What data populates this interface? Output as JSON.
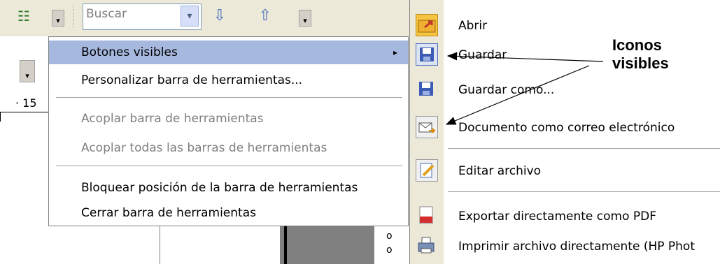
{
  "toolbar": {
    "search_placeholder": "Buscar",
    "search_combo_glyph": "▾",
    "icons": [
      "list-view-icon",
      "toolbar-options-icon",
      "search-down-icon",
      "search-up-icon",
      "toolbar-options-icon"
    ]
  },
  "ruler": {
    "value": "· 15"
  },
  "context_menu": {
    "items": [
      {
        "label": "Botones visibles",
        "enabled": true,
        "has_submenu": true,
        "highlighted": true
      },
      {
        "label": "Personalizar barra de herramientas...",
        "enabled": true
      },
      {
        "label": "Acoplar barra de herramientas",
        "enabled": false
      },
      {
        "label": "Acoplar todas las barras de herramientas",
        "enabled": false
      },
      {
        "label": "Bloquear posición de la barra de herramientas",
        "enabled": true
      },
      {
        "label": "Cerrar barra de herramientas",
        "enabled": true
      }
    ],
    "submenu_arrow": "▸"
  },
  "submenu": {
    "items": [
      {
        "label": "Abrir",
        "icon": "open-folder-icon"
      },
      {
        "label": "Guardar",
        "icon": "save-icon"
      },
      {
        "label": "Guardar como...",
        "icon": "save-as-icon"
      },
      {
        "label": "Documento como correo electrónico",
        "icon": "email-icon"
      },
      {
        "label": "Editar archivo",
        "icon": "edit-file-icon"
      },
      {
        "label": "Exportar directamente como PDF",
        "icon": "pdf-icon"
      },
      {
        "label": "Imprimir archivo directamente (HP Phot",
        "icon": "print-icon"
      }
    ]
  },
  "callout": {
    "line1": "Iconos",
    "line2": "visibles"
  },
  "colors": {
    "menu_highlight": "#a7b8df",
    "toolbar_bg": "#ece9d8"
  }
}
